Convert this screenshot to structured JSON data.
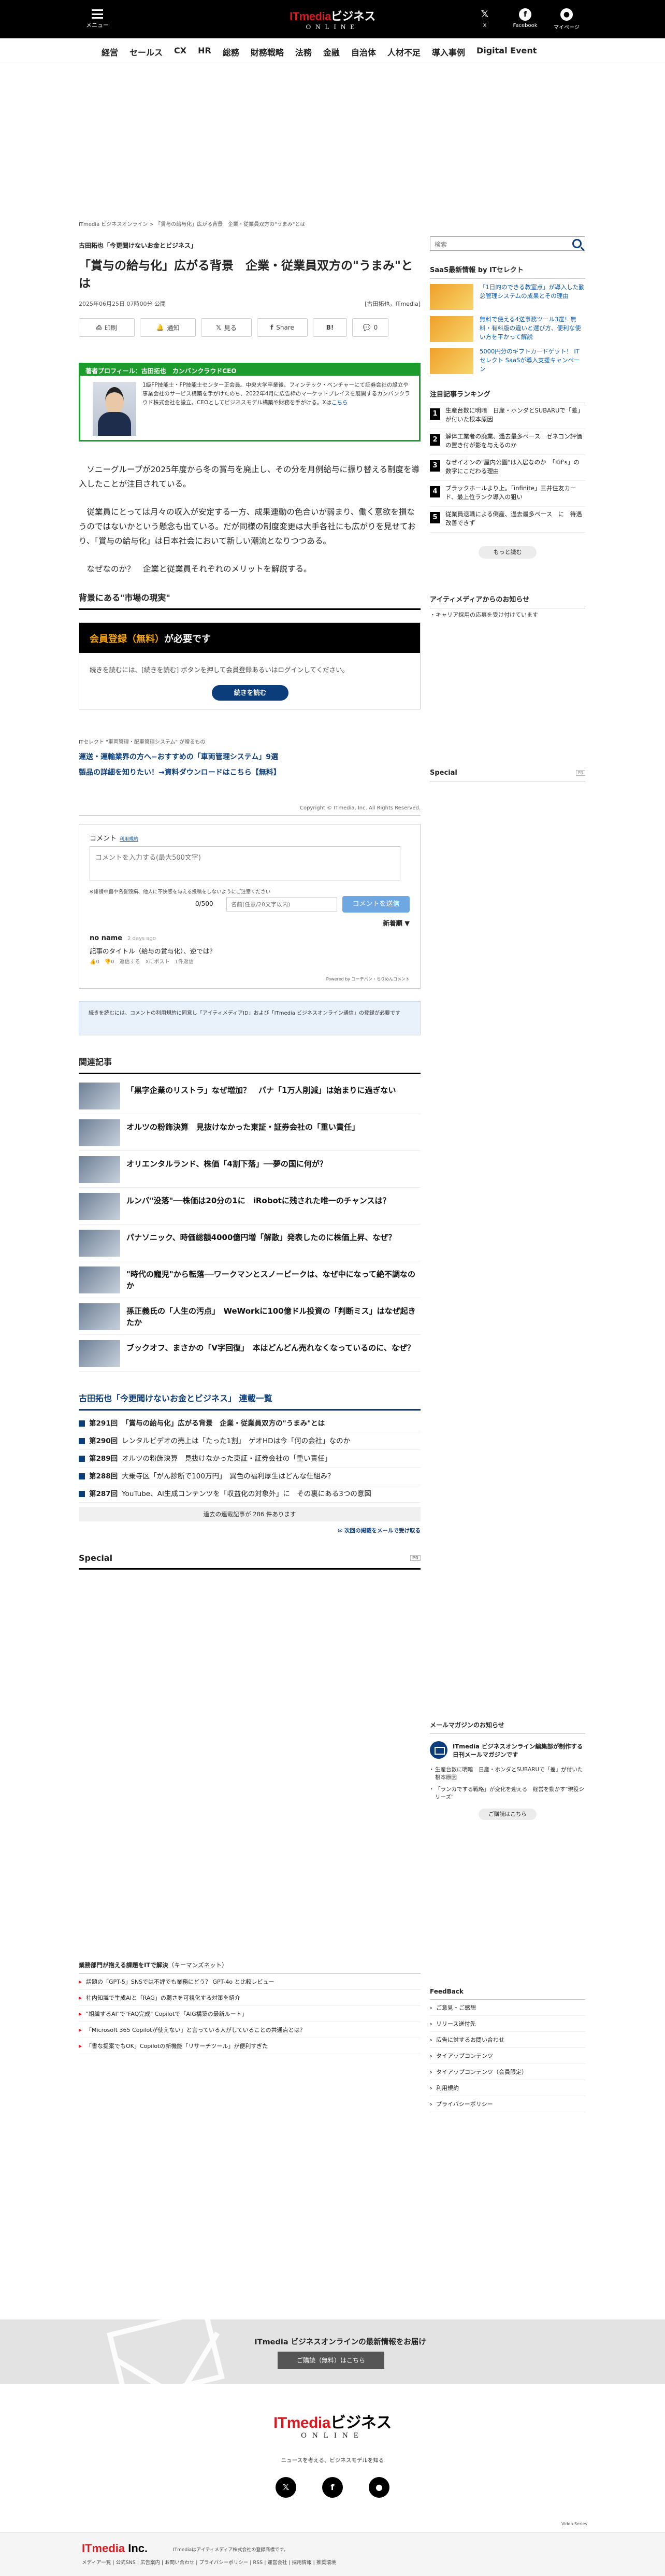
{
  "header": {
    "menu_label": "メニュー",
    "logo_main": "ITmedia",
    "logo_jp": "ビジネス",
    "logo_sub": "ONLINE",
    "x_label": "X",
    "facebook_label": "Facebook",
    "mypage_label": "マイページ",
    "bg_color": "#000000",
    "accent_color": "#d71920"
  },
  "category_nav": [
    "経営",
    "セールス",
    "CX",
    "HR",
    "総務",
    "財務戦略",
    "法務",
    "金融",
    "自治体",
    "人材不足",
    "導入事例",
    "Digital Event"
  ],
  "breadcrumb": "ITmedia ビジネスオンライン  >  「賃与の給与化」広がる背景　企業・従業員双方の\"うまみ\"とは",
  "article": {
    "series_tag": "古田拓也「今更聞けないお金とビジネス」",
    "title": "「賞与の給与化」広がる背景　企業・従業員双方の\"うまみ\"とは",
    "date": "2025年06月25日 07時00分 公開",
    "author": "[古田拓也，ITmedia]",
    "share": [
      {
        "label": "印刷",
        "icon": "print-icon"
      },
      {
        "label": "通知",
        "icon": "bell-icon"
      },
      {
        "label": "見る",
        "icon": "x-icon"
      },
      {
        "label": "Share",
        "icon": "facebook-icon"
      },
      {
        "label": "",
        "icon": "hatena-icon"
      },
      {
        "label": "0",
        "icon": "comment-icon"
      }
    ],
    "profile": {
      "heading": "著者プロフィール：古田拓也　カンバンクラウドCEO",
      "text": "1級FP技能士・FP技能士センター正会員。中央大学卒業後、フィンテック・ベンチャーにて証券会社の設立や事業会社のサービス構築を手がけたのち、2022年4月に広告枠のマーケットプレイスを展開するカンバンクラウド株式会社を設立。CEOとしてビジネスモデル構築や財務を手がける。Xは",
      "more": "こちら"
    },
    "paragraphs": [
      "ソニーグループが2025年度から冬の賞与を廃止し、その分を月例給与に振り替える制度を導入したことが注目されている。",
      "従業員にとっては月々の収入が安定する一方、成果連動の色合いが弱まり、働く意欲を損なうのではないかという懸念も出ている。だが同様の制度変更は大手各社にも広がりを見せており、「賞与の給与化」は日本社会において新しい潮流となりつつある。",
      "なぜなのか？　企業と従業員それぞれのメリットを解説する。"
    ],
    "section_heading": "背景にある\"市場の現実\""
  },
  "paywall": {
    "gold": "会員登録（無料）",
    "rest": "が必要です",
    "text": "続きを読むには、[続きを読む] ボタンを押して会員登録あるいはログインしてください。",
    "button": "続きを読む"
  },
  "promo": {
    "label": "ITセレクト \"車両管理・配車管理システム\" が贈るもの",
    "link1": "運送・運輸業界の方へ−おすすめの「車両管理システム」9選",
    "link2": "製品の詳細を知りたい！→資料ダウンロードはこちら【無料】"
  },
  "copyright": "Copyright © ITmedia, Inc. All Rights Reserved.",
  "comments": {
    "label": "コメント",
    "rule_link": "利用規約",
    "placeholder": "コメントを入力する(最大500文字)",
    "warning": "※誹謗中傷や名誉毀損、他人に不快感を与える投稿をしないようにご注意ください",
    "count": "0/500",
    "nick_placeholder": "名前(任意/20文字以内)",
    "send": "コメントを送信",
    "sort": "新着順 ▼",
    "user": "no name",
    "time": "2 days ago",
    "text": "記事のタイトル（給与の賞与化）、逆では？",
    "actions": "👍0　👎0　返信する　Xにポスト　1件返信",
    "powered": "Powered by コーデパン・ちりめんコメント"
  },
  "notice_box": "続きを読むには、コメントの利用規約に同意し「アイティメディアID」および「ITmedia ビジネスオンライン通信」の登録が必要です",
  "related": {
    "heading": "関連記事",
    "items": [
      "「黒字企業のリストラ」なぜ増加？　パナ「1万人削減」は始まりに過ぎない",
      "オルツの粉飾決算　見抜けなかった東証・証券会社の「重い責任」",
      "オリエンタルランド、株価「4割下落」──夢の国に何が？",
      "ルンバ\"没落\"──株価は20分の1に　iRobotに残された唯一のチャンスは？",
      "パナソニック、時価総額4000億円増「解散」発表したのに株価上昇、なぜ？",
      "\"時代の寵児\"から転落──ワークマンとスノーピークは、なぜ中になって絶不調なのか",
      "孫正義氏の「人生の汚点」　WeWorkに100億ドル投資の「判断ミス」はなぜ起きたか",
      "ブックオフ、まさかの「V字回復」　本はどんどん売れなくなっているのに、なぜ？"
    ]
  },
  "series": {
    "heading": "古田拓也「今更聞けないお金とビジネス」 連載一覧",
    "items": [
      {
        "num": "第291回",
        "title": "「賞与の給与化」広がる背景　企業・従業員双方の\"うまみ\"とは"
      },
      {
        "num": "第290回",
        "title": "レンタルビデオの売上は「たった1割」　ゲオHDは今「何の会社」なのか"
      },
      {
        "num": "第289回",
        "title": "オルツの粉飾決算　見抜けなかった東証・証券会社の「重い責任」"
      },
      {
        "num": "第288回",
        "title": "大乗寺区「がん診断で100万円」　異色の福利厚生はどんな仕組み？"
      },
      {
        "num": "第287回",
        "title": "YouTube、AI生成コンテンツを「収益化の対象外」に　その裏にある3つの意図"
      }
    ],
    "more": "過去の連載記事が 286 件あります",
    "mail": "✉ 次回の掲載をメールで受け取る"
  },
  "special_heading": "Special",
  "special_pr": "PR",
  "sidebar": {
    "search_placeholder": "検索",
    "select_heading": "SaaS最新情報 by ITセレクト",
    "select_items": [
      "「1日的のできる教室点」が導入した勤怠管理システムの成果とその理由",
      "無料で使える4送事務ツール3選！無料・有料版の違いと選び方、便利な使い方を平かって解説",
      "5000円分のギフトカードゲット！ ITセレクト SaaSが導入支援キャンペーン"
    ],
    "ranking_heading": "注目記事ランキング",
    "ranking": [
      "生産台数に明暗　日産・ホンダとSUBARUで「差」が付いた根本原因",
      "解体工業者の廃業、過去最多ペース　ゼネコン評価の置き付が影を与えるのか",
      "なぜイオンの\"屋内公園\"は入居なのか　「Kif's」の数字にこだわる理由",
      "ブラックホールより上。「infinite」三井住友カード、最上位ランク導入の狙い",
      "従業員退職による倒産、過去最多ペース　に　待遇改善できず"
    ],
    "ranking_more": "もっと読む",
    "notice_heading": "アイティメディアからのお知らせ",
    "notice_item": "・キャリア採用の応募を受け付けています",
    "special": "Special",
    "special_pr": "PR"
  },
  "mailmag": {
    "heading": "メールマガジンのお知らせ",
    "title": "ITmedia ビジネスオンライン編集部が制作する日刊メールマガジンです",
    "items": [
      "生産台数に明暗　日産・ホンダとSUBARUで「差」が付いた根本原因",
      "「ランカでする戦略」が変化を迎える　経営を動かす\"現役シリーズ\""
    ],
    "button": "ご購読はこちら"
  },
  "adbox": {
    "heading": "業務部門が抱える課題をITで解決",
    "heading_sub": "（キーマンズネット）",
    "items": [
      "話題の「GPT-5」SNSでは不評でも業務にどう？ GPT-4o と比較レビュー",
      "社内知識で生成AIと「RAG」の弱さを可視化する対策を紹介",
      "\"組織するAI\"で\"FAQ完成\" Copilotで「AIG構築の最新ルート」",
      "「Microsoft 365 Copilotが使えない」と言っている人がしていることの共通点とは？",
      "「書な提案でもOK」Copilotの新機能「リサーチツール」が便利すぎた"
    ]
  },
  "feedback": {
    "heading": "FeedBack",
    "items": [
      "ご意見・ご感想",
      "リリース送付先",
      "広告に対するお問い合わせ",
      "タイアップコンテンツ",
      "タイアップコンテンツ（会員限定）",
      "利用規約",
      "プライバシーポリシー"
    ]
  },
  "newsletter": {
    "text": "ITmedia ビジネスオンラインの最新情報をお届け",
    "button": "ご購読（無料）はこちら"
  },
  "footer": {
    "logo_main": "ITmedia",
    "logo_jp": "ビジネス",
    "logo_sub": "ONLINE",
    "tagline": "ニュースを考える、ビジネスモデルを知る",
    "video": "Video Series",
    "corp_main": "ITmedia",
    "corp_suffix": " Inc.",
    "corp_note": "ITmediaはアイティメディア株式会社の登録商標です。",
    "links": "メディア一覧 | 公式SNS | 広告案内 | お問い合わせ | プライバシーポリシー | RSS | 運営会社 | 採用情報 | 推奨環境"
  }
}
